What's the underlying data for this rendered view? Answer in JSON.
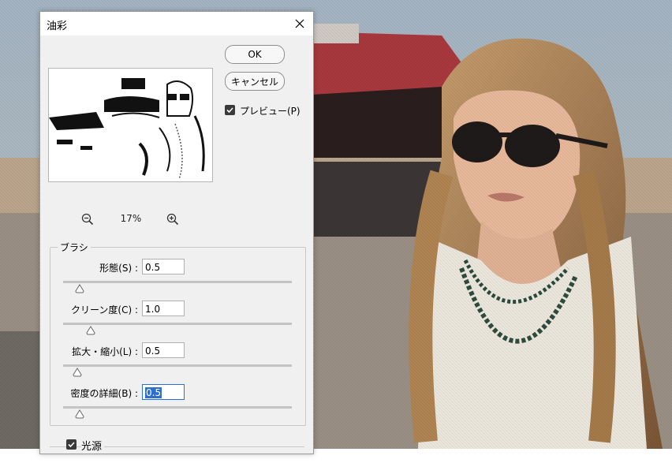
{
  "dialog": {
    "title": "油彩",
    "close_icon": "close-icon"
  },
  "buttons": {
    "ok": "OK",
    "cancel": "キャンセル"
  },
  "preview": {
    "label": "プレビュー(P)",
    "checked": true
  },
  "zoom": {
    "value": "17%",
    "zoom_out_icon": "zoom-out-icon",
    "zoom_in_icon": "zoom-in-icon"
  },
  "brush": {
    "title": "ブラシ",
    "params": [
      {
        "label": "形態(S) :",
        "value": "0.5",
        "slider": 0.05
      },
      {
        "label": "クリーン度(C) :",
        "value": "1.0",
        "slider": 0.1
      },
      {
        "label": "拡大・縮小(L) :",
        "value": "0.5",
        "slider": 0.04
      },
      {
        "label": "密度の詳細(B) :",
        "value": "0.5",
        "slider": 0.05
      }
    ]
  },
  "lighting": {
    "title": "光源",
    "checked": true
  },
  "colors": {
    "accent": "#2d6fd1",
    "dialog_bg": "#f0f0f0"
  }
}
